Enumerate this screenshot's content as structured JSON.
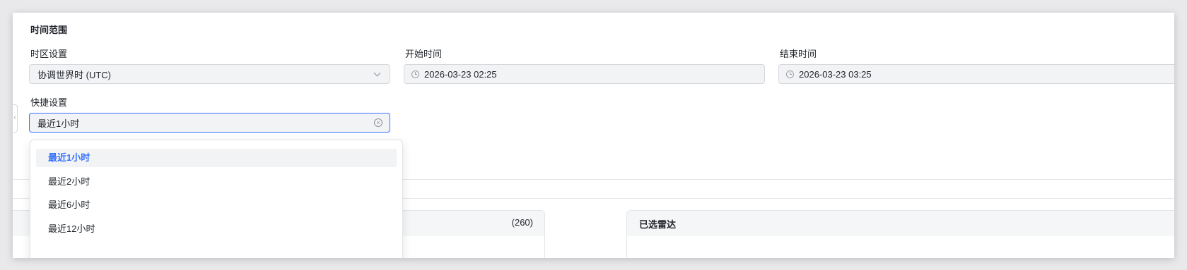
{
  "section_title": "时间范围",
  "timezone": {
    "label": "时区设置",
    "value": "协调世界时 (UTC)"
  },
  "start_time": {
    "label": "开始时间",
    "value": "2026-03-23 02:25"
  },
  "end_time": {
    "label": "结束时间",
    "value": "2026-03-23 03:25"
  },
  "quick": {
    "label": "快捷设置",
    "value": "最近1小时",
    "options": [
      "最近1小时",
      "最近2小时",
      "最近6小时",
      "最近12小时"
    ],
    "selected_index": 0
  },
  "left_panel": {
    "count": "(260)"
  },
  "right_panel": {
    "title": "已选雷达"
  },
  "colors": {
    "accent": "#3370ff",
    "field_bg": "#f2f3f5"
  },
  "icons": [
    "chevron-down-icon",
    "clock-icon",
    "clear-icon",
    "chevron-left-icon"
  ]
}
